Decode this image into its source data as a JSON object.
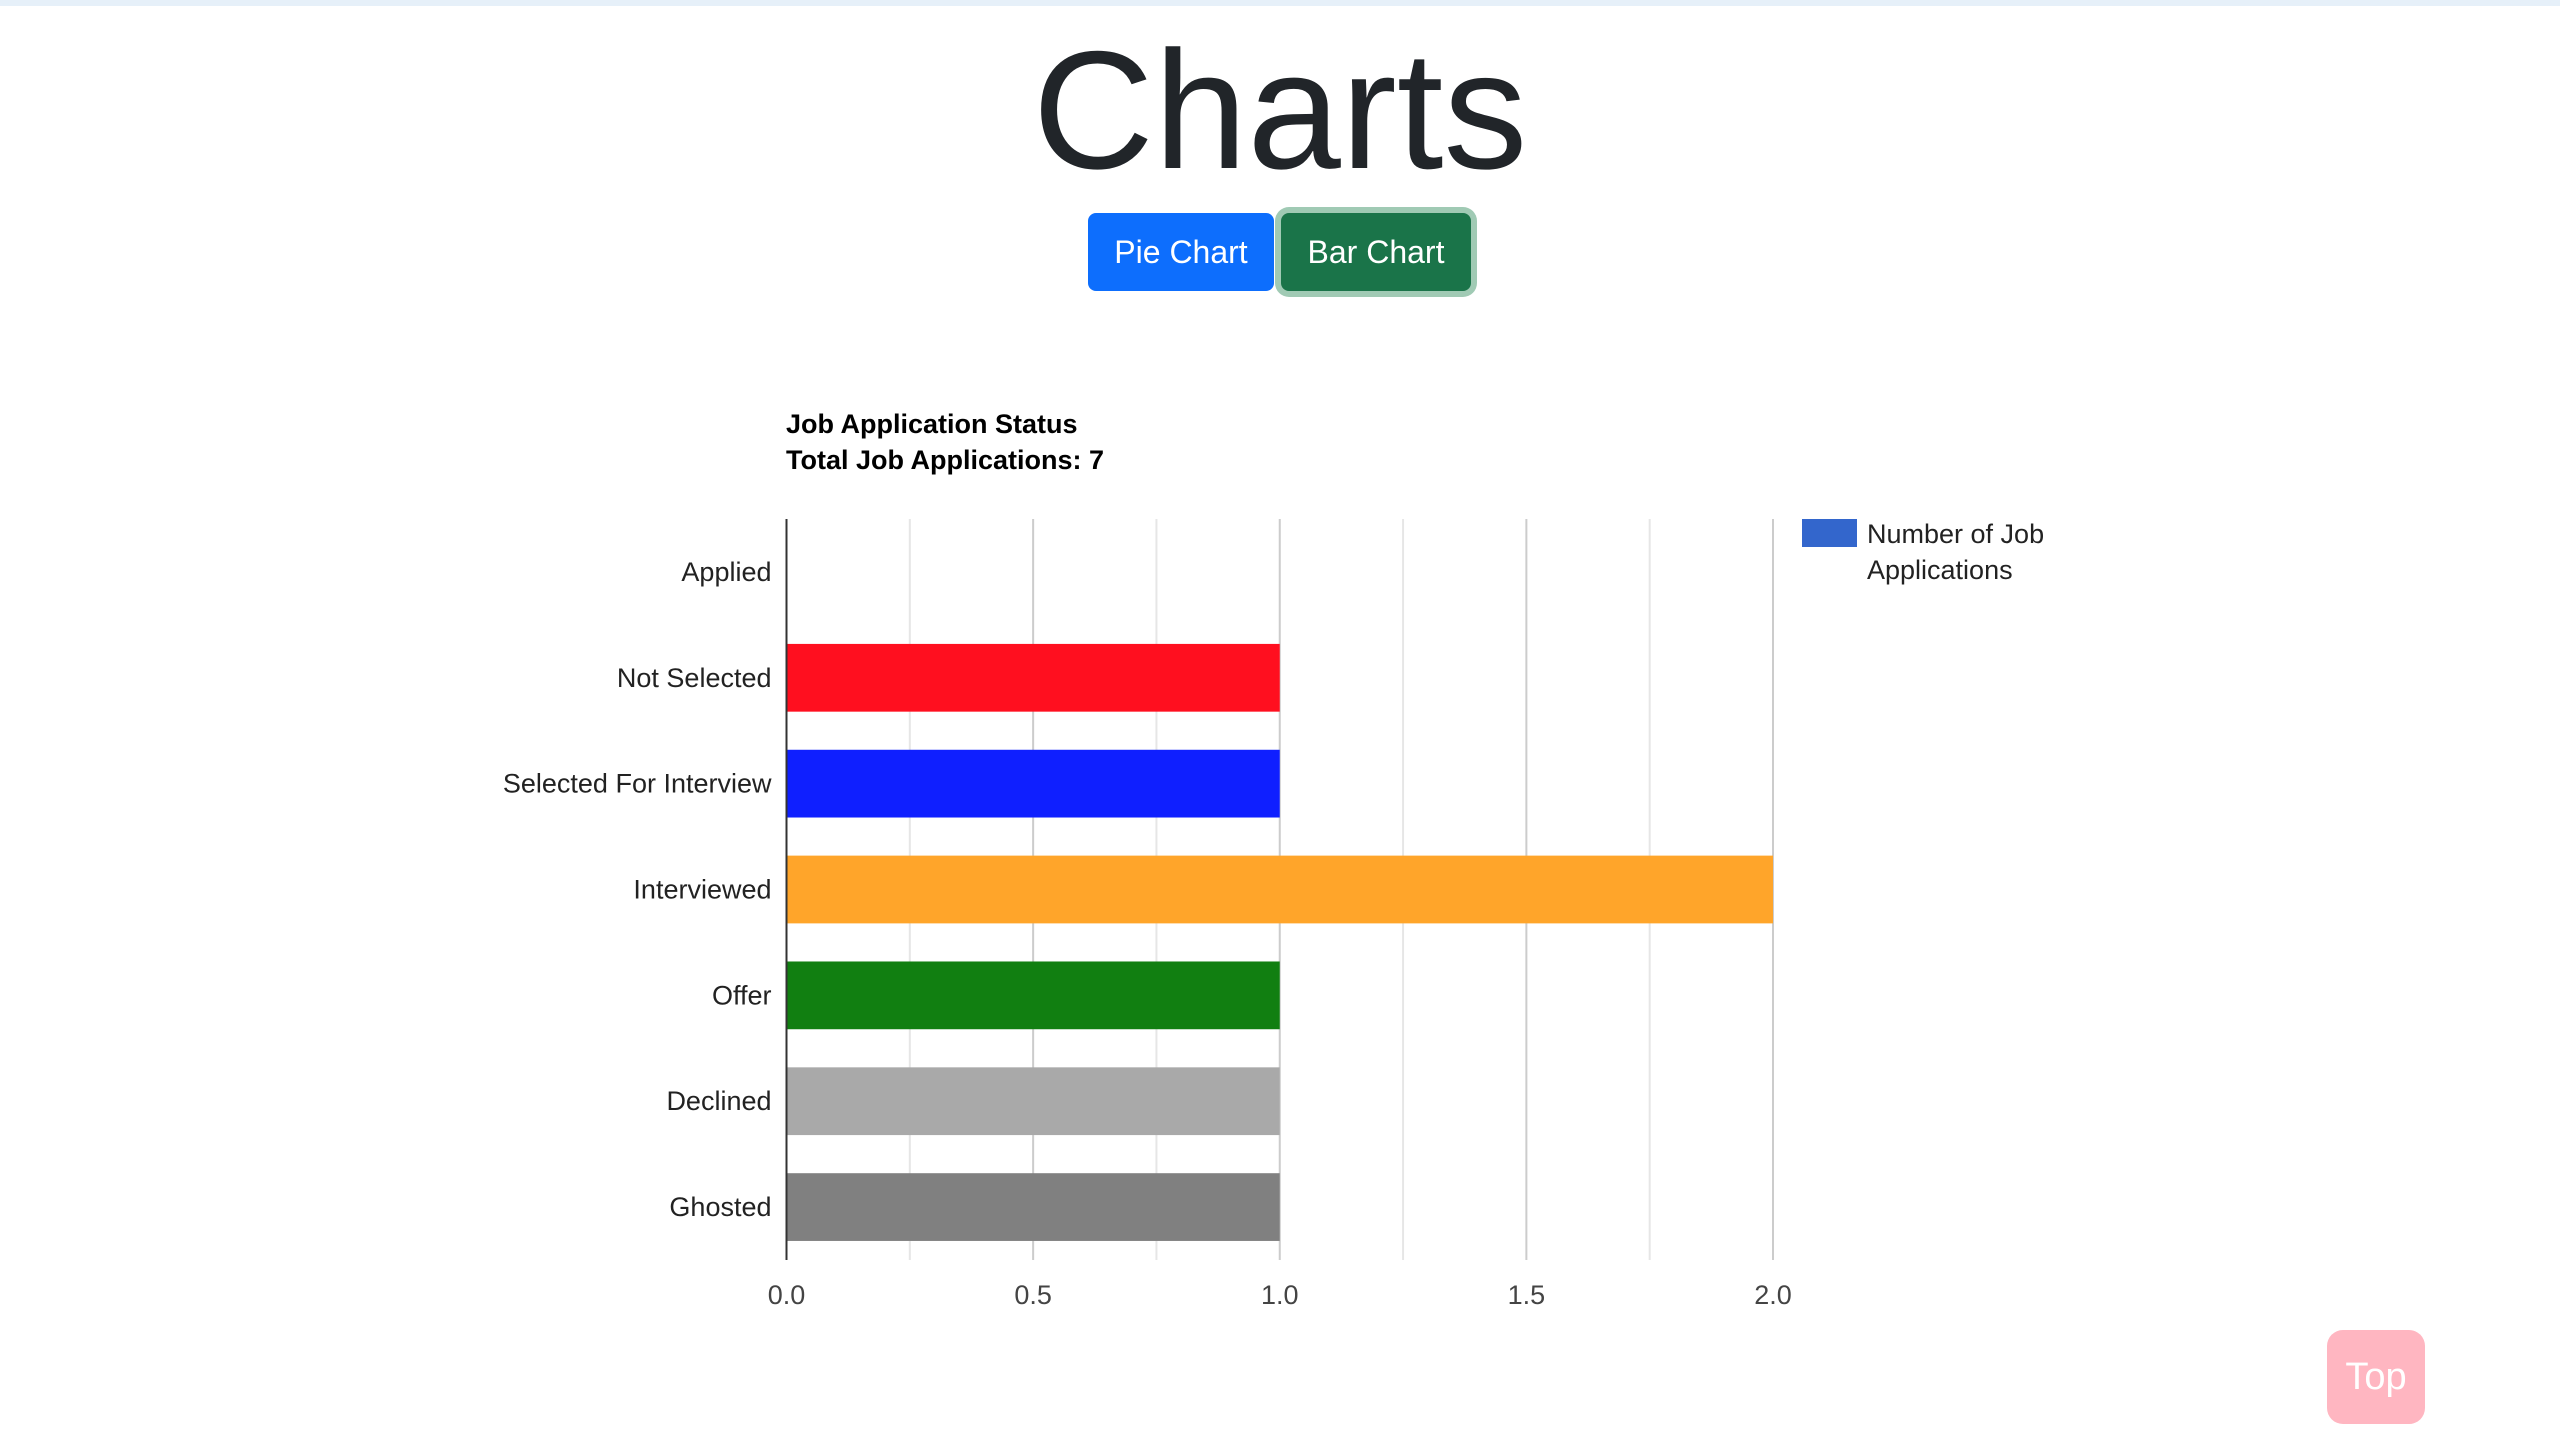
{
  "page": {
    "title": "Charts"
  },
  "buttons": {
    "pie_label": "Pie Chart",
    "bar_label": "Bar Chart",
    "top_label": "Top"
  },
  "chart_data": {
    "type": "bar",
    "orientation": "horizontal",
    "title": "Job Application Status",
    "subtitle": "Total Job Applications: 7",
    "categories": [
      "Applied",
      "Not Selected",
      "Selected For Interview",
      "Interviewed",
      "Offer",
      "Declined",
      "Ghosted"
    ],
    "series": [
      {
        "name": "Number of Job Applications",
        "values": [
          0,
          1,
          1,
          2,
          1,
          1,
          1
        ],
        "colors": [
          "#3366cc",
          "#ff0f1f",
          "#0f1fff",
          "#ffa52a",
          "#117f11",
          "#a9a9a9",
          "#808080"
        ]
      }
    ],
    "legend_color": "#3366cc",
    "xlim": [
      0,
      2
    ],
    "xticks": [
      "0.0",
      "0.5",
      "1.0",
      "1.5",
      "2.0"
    ],
    "grid": true,
    "legend_position": "right"
  }
}
